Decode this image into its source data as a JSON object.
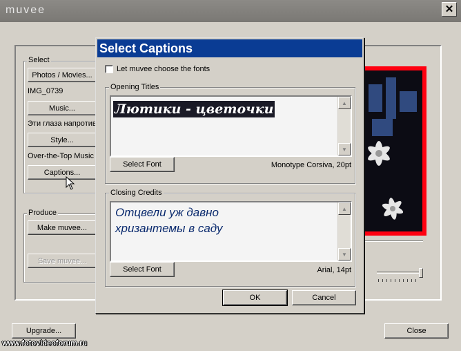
{
  "app": {
    "title": "muvee",
    "close_glyph": "✕"
  },
  "select_group": {
    "label": "Select",
    "photos_button": "Photos / Movies...",
    "photos_value": "IMG_0739",
    "music_button": "Music...",
    "music_value": "Эти глаза напротив",
    "style_button": "Style...",
    "style_value": "Over-the-Top Music",
    "captions_button": "Captions..."
  },
  "produce_group": {
    "label": "Produce",
    "make_button": "Make muvee...",
    "save_button": "Save muvee..."
  },
  "bottom": {
    "upgrade_button": "Upgrade...",
    "close_button": "Close",
    "watermark": "www.fotovideoforum.ru"
  },
  "dialog": {
    "title": "Select Captions",
    "checkbox_label": "Let muvee choose the fonts",
    "checkbox_checked": false,
    "opening": {
      "label": "Opening Titles",
      "text": "Лютики - цветочки",
      "select_font_button": "Select Font",
      "font_info": "Monotype Corsiva, 20pt"
    },
    "closing": {
      "label": "Closing Credits",
      "line1": "Отцвели уж давно",
      "line2": "хризантемы в саду",
      "select_font_button": "Select Font",
      "font_info": "Arial, 14pt"
    },
    "ok_button": "OK",
    "cancel_button": "Cancel"
  },
  "colors": {
    "dialog_title_bg": "#0a3c94",
    "caption_text": "#0a2a6e",
    "preview_border": "#ff0010"
  },
  "icons": {
    "scroll_up": "scroll-up-arrow-icon",
    "scroll_down": "scroll-down-arrow-icon",
    "cursor": "mouse-pointer-icon"
  }
}
